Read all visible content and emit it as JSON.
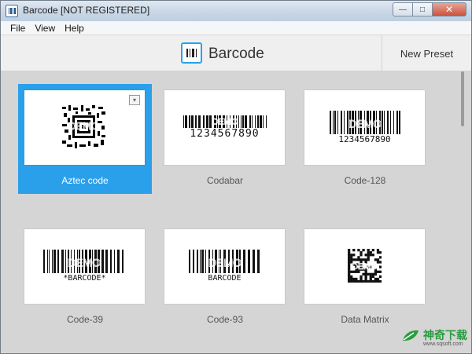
{
  "window": {
    "title": "Barcode [NOT REGISTERED]",
    "minimize_glyph": "—",
    "maximize_glyph": "□",
    "close_glyph": "✕"
  },
  "menu": {
    "items": [
      "File",
      "View",
      "Help"
    ]
  },
  "header": {
    "title": "Barcode",
    "new_preset_label": "New Preset"
  },
  "presets": [
    {
      "label": "Aztec code",
      "selected": true,
      "text": ""
    },
    {
      "label": "Codabar",
      "selected": false,
      "text": "1234567890"
    },
    {
      "label": "Code-128",
      "selected": false,
      "text": "1234567890"
    },
    {
      "label": "Code-39",
      "selected": false,
      "text": "*BARCODE*"
    },
    {
      "label": "Code-93",
      "selected": false,
      "text": "BARCODE"
    },
    {
      "label": "Data Matrix",
      "selected": false,
      "text": ""
    }
  ],
  "overlay_text": "DEMO",
  "dropdown_glyph": "▾",
  "watermark": {
    "text": "神奇下载",
    "url": "www.sqsoft.com"
  },
  "colors": {
    "accent": "#2ba0ea",
    "watermark": "#2a9d3f"
  }
}
